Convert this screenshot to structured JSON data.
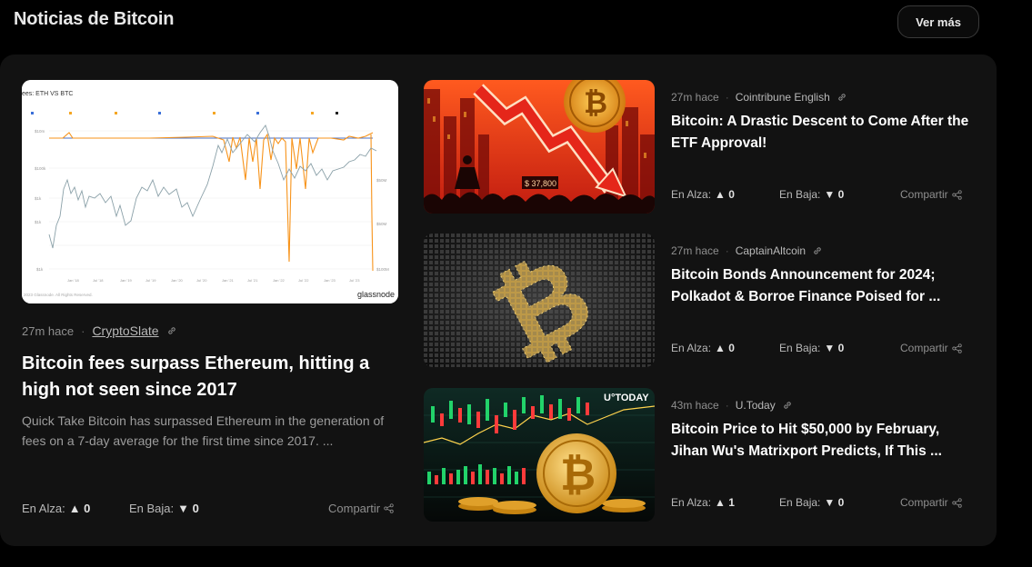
{
  "header": {
    "title": "Noticias de Bitcoin",
    "more_label": "Ver más"
  },
  "featured": {
    "time": "27m hace",
    "source": "CryptoSlate",
    "title": "Bitcoin fees surpass Ethereum, hitting a high not seen since 2017",
    "description": "Quick Take Bitcoin has surpassed Ethereum in the generation of fees on a 7-day average for the first time since 2017. ...",
    "up_label": "En Alza:",
    "up_value": "▲ 0",
    "down_label": "En Baja:",
    "down_value": "▼ 0",
    "share_label": "Compartir",
    "image": {
      "chart_title": "ees: ETH VS BTC",
      "watermark": "glassnode",
      "copyright": "2023 Glassnode. All Rights Reserved."
    }
  },
  "items": [
    {
      "time": "27m hace",
      "source": "Cointribune English",
      "title": "Bitcoin: A Drastic Descent to Come After the ETF Approval!",
      "up_label": "En Alza:",
      "up_value": "▲ 0",
      "down_label": "En Baja:",
      "down_value": "▼ 0",
      "share_label": "Compartir"
    },
    {
      "time": "27m hace",
      "source": "CaptainAltcoin",
      "title": "Bitcoin Bonds Announcement for 2024; Polkadot & Borroe Finance Poised for ...",
      "up_label": "En Alza:",
      "up_value": "▲ 0",
      "down_label": "En Baja:",
      "down_value": "▼ 0",
      "share_label": "Compartir"
    },
    {
      "time": "43m hace",
      "source": "U.Today",
      "title": "Bitcoin Price to Hit $50,000 by February, Jihan Wu's Matrixport Predicts, If This ...",
      "up_label": "En Alza:",
      "up_value": "▲ 1",
      "down_label": "En Baja:",
      "down_value": "▼ 0",
      "share_label": "Compartir",
      "image_text": "U°TODAY"
    }
  ],
  "colors": {
    "accent_orange": "#f7931a",
    "panel": "#121212",
    "background": "#000000"
  }
}
